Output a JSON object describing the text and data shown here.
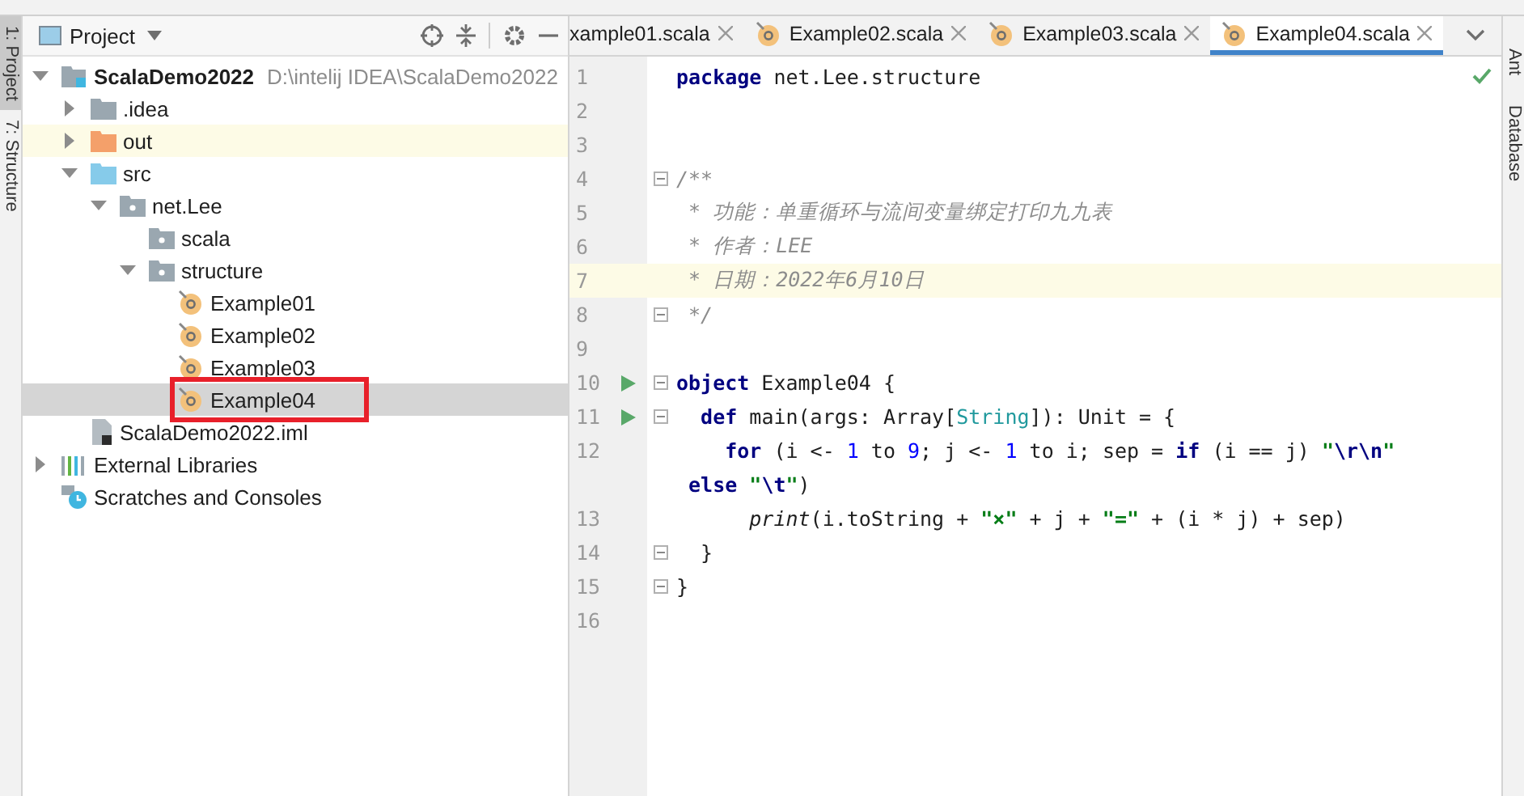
{
  "tool_strip_left": [
    {
      "label": "1: Project",
      "selected": true
    },
    {
      "label": "7: Structure",
      "selected": false
    }
  ],
  "project_panel": {
    "title": "Project",
    "tree": [
      {
        "label": "ScalaDemo2022",
        "path": "D:\\intelij IDEA\\ScalaDemo2022",
        "kind": "module",
        "expanded": true,
        "children": [
          {
            "label": ".idea",
            "kind": "folder",
            "expanded": false
          },
          {
            "label": "out",
            "kind": "excluded",
            "expanded": false,
            "highlighted": true
          },
          {
            "label": "src",
            "kind": "source",
            "expanded": true,
            "children": [
              {
                "label": "net.Lee",
                "kind": "package",
                "expanded": true,
                "children": [
                  {
                    "label": "scala",
                    "kind": "package"
                  },
                  {
                    "label": "structure",
                    "kind": "package",
                    "expanded": true,
                    "children": [
                      {
                        "label": "Example01",
                        "kind": "object",
                        "selected": false,
                        "annotated": false
                      },
                      {
                        "label": "Example02",
                        "kind": "object",
                        "selected": false,
                        "annotated": false
                      },
                      {
                        "label": "Example03",
                        "kind": "object",
                        "selected": false,
                        "annotated": false
                      },
                      {
                        "label": "Example04",
                        "kind": "object",
                        "selected": true,
                        "annotated": true
                      }
                    ]
                  }
                ]
              }
            ]
          },
          {
            "label": "ScalaDemo2022.iml",
            "kind": "iml"
          }
        ]
      },
      {
        "label": "External Libraries",
        "kind": "libraries",
        "expanded": false
      },
      {
        "label": "Scratches and Consoles",
        "kind": "scratches"
      }
    ]
  },
  "tabs": [
    {
      "label": "xample01.scala",
      "selected": false,
      "icon": false
    },
    {
      "label": "Example02.scala",
      "selected": false,
      "icon": true
    },
    {
      "label": "Example03.scala",
      "selected": false,
      "icon": true
    },
    {
      "label": "Example04.scala",
      "selected": true,
      "icon": true
    }
  ],
  "editor": {
    "lines": [
      {
        "number": "1",
        "tokens": [
          {
            "kind": "keyword",
            "text": "package"
          },
          {
            "kind": "plain",
            "text": " net.Lee.structure"
          }
        ]
      },
      {
        "number": "2"
      },
      {
        "number": "3"
      },
      {
        "number": "4",
        "fold": true,
        "tokens": [
          {
            "kind": "comment",
            "text": "/**"
          }
        ]
      },
      {
        "number": "5",
        "tokens": [
          {
            "kind": "comment",
            "text": " * 功能：单重循环与流间变量绑定打印九九表"
          }
        ]
      },
      {
        "number": "6",
        "tokens": [
          {
            "kind": "comment",
            "text": " * 作者：LEE"
          }
        ]
      },
      {
        "number": "7",
        "current": true,
        "tokens": [
          {
            "kind": "comment",
            "text": " * 日期：2022年6月10日"
          }
        ]
      },
      {
        "number": "8",
        "fold": true,
        "tokens": [
          {
            "kind": "comment",
            "text": " */"
          }
        ]
      },
      {
        "number": "9"
      },
      {
        "number": "10",
        "run": true,
        "fold": true,
        "tokens": [
          {
            "kind": "keyword",
            "text": "object"
          },
          {
            "kind": "plain",
            "text": " Example04 {"
          }
        ]
      },
      {
        "number": "11",
        "run": true,
        "fold": true,
        "tokens": [
          {
            "kind": "keyword",
            "text": "  def"
          },
          {
            "kind": "plain",
            "text": " main(args: Array["
          },
          {
            "kind": "type",
            "text": "String"
          },
          {
            "kind": "plain",
            "text": "]): Unit = {"
          }
        ]
      },
      {
        "number": "12",
        "tokens": [
          {
            "kind": "keyword",
            "text": "    for"
          },
          {
            "kind": "plain",
            "text": " (i <- "
          },
          {
            "kind": "number",
            "text": "1"
          },
          {
            "kind": "plain",
            "text": " to "
          },
          {
            "kind": "number",
            "text": "9"
          },
          {
            "kind": "plain",
            "text": "; j <- "
          },
          {
            "kind": "number",
            "text": "1"
          },
          {
            "kind": "plain",
            "text": " to i; sep = "
          },
          {
            "kind": "keyword",
            "text": "if"
          },
          {
            "kind": "plain",
            "text": " (i == j) "
          },
          {
            "kind": "string",
            "text": "\""
          },
          {
            "kind": "escape",
            "text": "\\r\\n"
          },
          {
            "kind": "string",
            "text": "\""
          }
        ]
      },
      {
        "tokens": [
          {
            "kind": "keyword",
            "text": " else"
          },
          {
            "kind": "string",
            "text": " \""
          },
          {
            "kind": "escape",
            "text": "\\t"
          },
          {
            "kind": "string",
            "text": "\""
          },
          {
            "kind": "plain",
            "text": ")"
          }
        ]
      },
      {
        "number": "13",
        "tokens": [
          {
            "kind": "function",
            "text": "      print"
          },
          {
            "kind": "plain",
            "text": "(i.toString + "
          },
          {
            "kind": "string",
            "text": "\"×\""
          },
          {
            "kind": "plain",
            "text": " + j + "
          },
          {
            "kind": "string",
            "text": "\"=\""
          },
          {
            "kind": "plain",
            "text": " + (i * j) + sep)"
          }
        ]
      },
      {
        "number": "14",
        "fold": true,
        "tokens": [
          {
            "kind": "plain",
            "text": "  }"
          }
        ]
      },
      {
        "number": "15",
        "fold": true,
        "tokens": [
          {
            "kind": "plain",
            "text": "}"
          }
        ]
      },
      {
        "number": "16"
      }
    ]
  },
  "tool_strip_right": [
    {
      "label": "Ant"
    },
    {
      "label": "Database"
    }
  ]
}
